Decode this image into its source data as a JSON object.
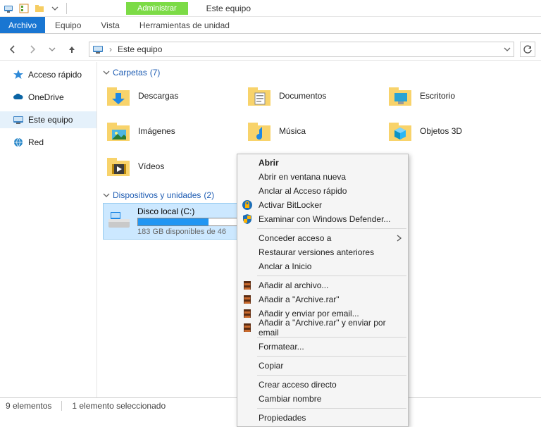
{
  "window": {
    "title": "Este equipo",
    "context_tab": "Administrar"
  },
  "ribbon": {
    "file": "Archivo",
    "tabs": [
      "Equipo",
      "Vista",
      "Herramientas de unidad"
    ]
  },
  "nav": {
    "crumb": "Este equipo",
    "sep": "›"
  },
  "sidebar": {
    "items": [
      {
        "label": "Acceso rápido"
      },
      {
        "label": "OneDrive"
      },
      {
        "label": "Este equipo"
      },
      {
        "label": "Red"
      }
    ]
  },
  "groups": {
    "folders": {
      "label": "Carpetas",
      "count": "(7)"
    },
    "drives": {
      "label": "Dispositivos y unidades",
      "count": "(2)"
    }
  },
  "folders": [
    {
      "label": "Descargas"
    },
    {
      "label": "Documentos"
    },
    {
      "label": "Escritorio"
    },
    {
      "label": "Imágenes"
    },
    {
      "label": "Música"
    },
    {
      "label": "Objetos 3D"
    },
    {
      "label": "Vídeos"
    }
  ],
  "drive": {
    "name": "Disco local (C:)",
    "status": "183 GB disponibles de 46"
  },
  "context_menu": {
    "items": [
      {
        "label": "Abrir",
        "bold": true
      },
      {
        "label": "Abrir en ventana nueva"
      },
      {
        "label": "Anclar al Acceso rápido"
      },
      {
        "label": "Activar BitLocker",
        "icon": "bitlocker"
      },
      {
        "label": "Examinar con Windows Defender...",
        "icon": "defender"
      },
      {
        "sep": true
      },
      {
        "label": "Conceder acceso a",
        "submenu": true
      },
      {
        "label": "Restaurar versiones anteriores"
      },
      {
        "label": "Anclar a Inicio"
      },
      {
        "sep": true
      },
      {
        "label": "Añadir al archivo...",
        "icon": "rar"
      },
      {
        "label": "Añadir a \"Archive.rar\"",
        "icon": "rar"
      },
      {
        "label": "Añadir y enviar por email...",
        "icon": "rar"
      },
      {
        "label": "Añadir a \"Archive.rar\" y enviar por email",
        "icon": "rar"
      },
      {
        "sep": true
      },
      {
        "label": "Formatear..."
      },
      {
        "sep": true
      },
      {
        "label": "Copiar"
      },
      {
        "sep": true
      },
      {
        "label": "Crear acceso directo"
      },
      {
        "label": "Cambiar nombre"
      },
      {
        "sep": true
      },
      {
        "label": "Propiedades"
      }
    ]
  },
  "status": {
    "items": "9 elementos",
    "selected": "1 elemento seleccionado"
  }
}
